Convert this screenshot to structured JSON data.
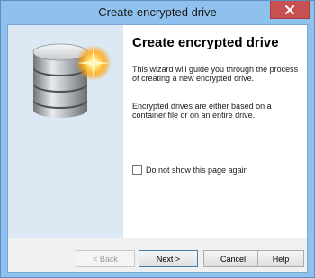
{
  "window": {
    "title": "Create encrypted drive",
    "close_glyph": "✕"
  },
  "sidepanel": {
    "icon": "database-icon"
  },
  "content": {
    "heading": "Create encrypted drive",
    "paragraph1": "This wizard will guide you through the process of creating a new encrypted drive.",
    "paragraph2": "Encrypted drives are either based on a container file or on an entire drive.",
    "checkbox_label": "Do not show this page again",
    "checkbox_checked": false
  },
  "buttons": {
    "back": "< Back",
    "next": "Next >",
    "cancel": "Cancel",
    "help": "Help"
  },
  "colors": {
    "titlebar": "#8fc1ee",
    "close": "#c75050",
    "sidepanel": "#dce9f5"
  }
}
